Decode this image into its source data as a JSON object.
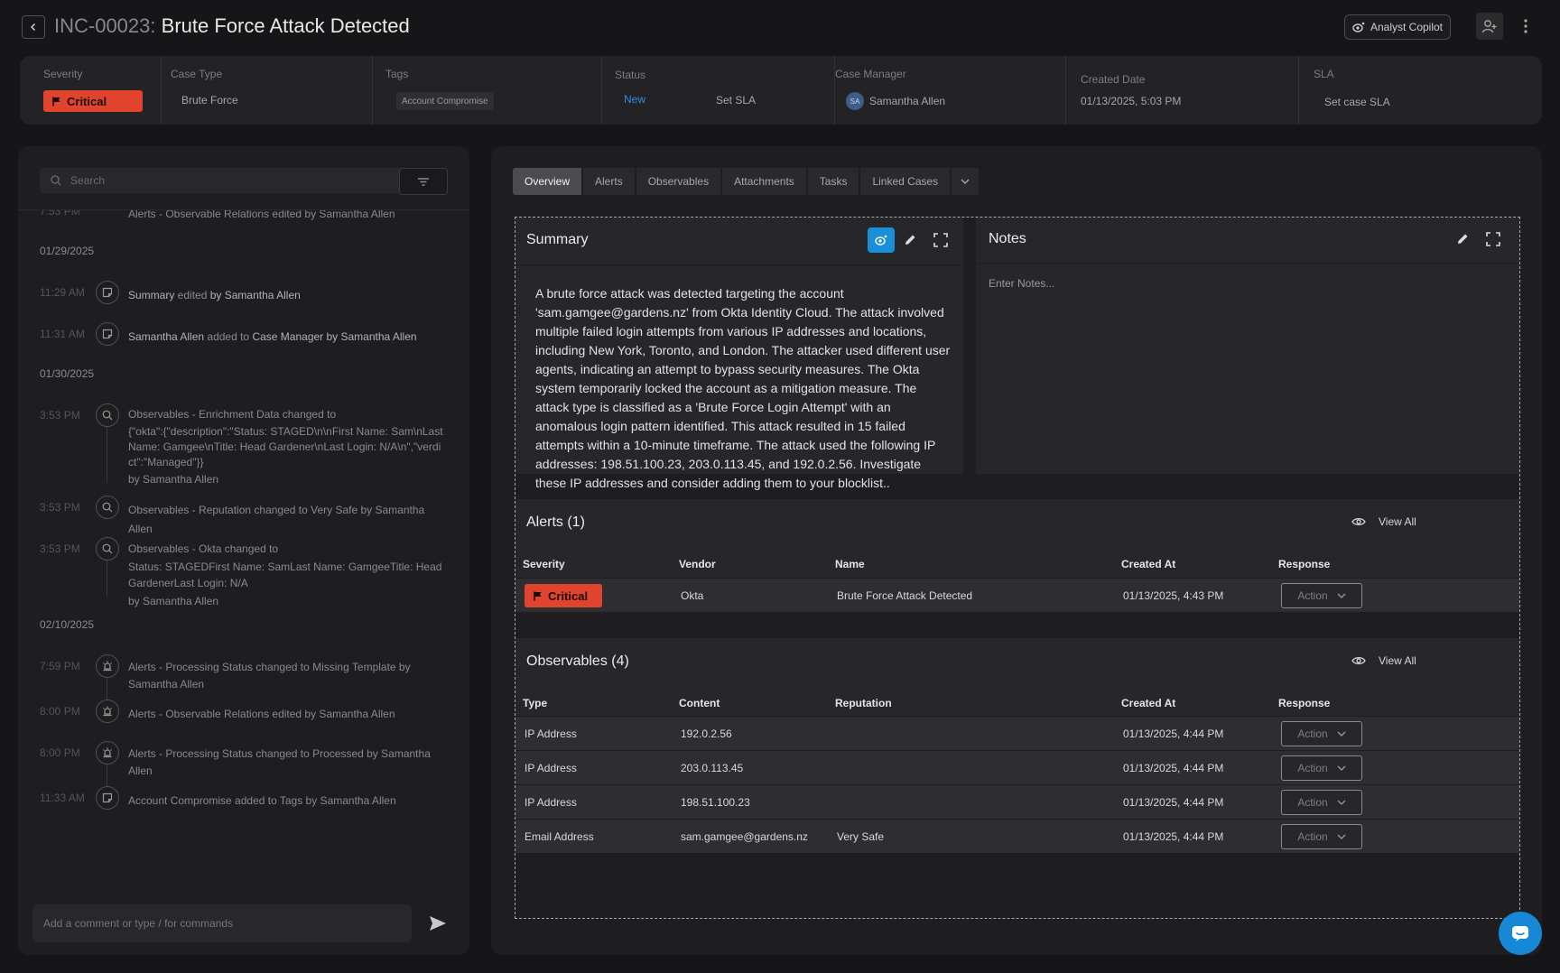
{
  "header": {
    "incident_id": "INC-00023:",
    "incident_title": "Brute Force Attack Detected",
    "copilot_label": "Analyst Copilot"
  },
  "info": {
    "severity_label": "Severity",
    "severity_value": "Critical",
    "case_type_label": "Case Type",
    "case_type_value": "Brute Force",
    "tags_label": "Tags",
    "tag_value": "Account Compromise",
    "status_label": "Status",
    "status_value": "New",
    "set_sla": "Set SLA",
    "case_manager_label": "Case Manager",
    "case_manager_initials": "SA",
    "case_manager_value": "Samantha Allen",
    "created_date_label": "Created Date",
    "created_date_value": "01/13/2025, 5:03 PM",
    "sla_label": "SLA",
    "sla_value": "Set case SLA",
    "colors": {
      "critical": "#e0432e",
      "status_new": "#2d8fe0"
    }
  },
  "activity": {
    "search_placeholder": "Search",
    "partial_top": {
      "time": "7:53 PM",
      "text": "Alerts - Observable Relations edited by Samantha Allen"
    },
    "groups": [
      {
        "date": "01/29/2025",
        "items": [
          {
            "time": "11:29 AM",
            "icon": "note-icon",
            "segments": [
              "Summary",
              " edited ",
              "by Samantha Allen"
            ]
          },
          {
            "time": "11:31 AM",
            "icon": "note-icon",
            "segments": [
              "Samantha Allen",
              " added to ",
              "Case Manager by Samantha Allen"
            ]
          }
        ]
      },
      {
        "date": "01/30/2025",
        "items": [
          {
            "time": "3:53 PM",
            "icon": "search-icon",
            "line1": "Observables - Enrichment Data changed to",
            "line2": "{\"okta\":{\"description\":\"Status: STAGED\\n\\nFirst Name: Sam\\nLast Name: Gamgee\\nTitle: Head Gardener\\nLast Login: N/A\\n\",\"verdict\":\"Managed\"}}",
            "by": "by Samantha Allen"
          },
          {
            "time": "3:53 PM",
            "icon": "search-icon",
            "line1": "Observables - Reputation changed to Very Safe by Samantha Allen"
          },
          {
            "time": "3:53 PM",
            "icon": "search-icon",
            "line1": "Observables - Okta changed to",
            "line2": "Status: STAGEDFirst Name: SamLast Name: GamgeeTitle: Head GardenerLast Login: N/A",
            "by": "by Samantha Allen"
          }
        ]
      },
      {
        "date": "02/10/2025",
        "items": [
          {
            "time": "7:59 PM",
            "icon": "siren-icon",
            "line1": "Alerts - Processing Status changed to Missing Template by Samantha Allen"
          },
          {
            "time": "8:00 PM",
            "icon": "siren-icon",
            "line1": "Alerts - Observable Relations edited by Samantha Allen"
          },
          {
            "time": "8:00 PM",
            "icon": "siren-icon",
            "line1": "Alerts - Processing Status changed to Processed by Samantha Allen"
          },
          {
            "time": "11:33 AM",
            "icon": "note-icon",
            "line1": "Account Compromise added to Tags by Samantha Allen"
          }
        ]
      }
    ],
    "comment_placeholder": "Add a comment or type / for commands"
  },
  "tabs": [
    "Overview",
    "Alerts",
    "Observables",
    "Attachments",
    "Tasks",
    "Linked Cases"
  ],
  "summary": {
    "title": "Summary",
    "text": "A brute force attack was detected targeting the account 'sam.gamgee@gardens.nz' from Okta Identity Cloud. The attack involved multiple failed login attempts from various IP addresses and locations, including New York, Toronto, and London. The attacker used different user agents, indicating an attempt to bypass security measures.  The Okta system temporarily locked the account as a mitigation measure. The attack type is classified as a 'Brute Force Login Attempt' with an anomalous login pattern identified. This attack resulted in 15 failed attempts within a 10-minute timeframe.  The attack used the following IP addresses: 198.51.100.23, 203.0.113.45, and 192.0.2.56.  Investigate these IP addresses and consider adding them to your blocklist.."
  },
  "notes": {
    "title": "Notes",
    "placeholder": "Enter Notes..."
  },
  "alerts": {
    "title": "Alerts (1)",
    "view_all": "View All",
    "columns": [
      "Severity",
      "Vendor",
      "Name",
      "Created At",
      "Response"
    ],
    "rows": [
      {
        "severity": "Critical",
        "vendor": "Okta",
        "name": "Brute Force Attack Detected",
        "created_at": "01/13/2025, 4:43 PM",
        "response": "Action"
      }
    ]
  },
  "observables": {
    "title": "Observables (4)",
    "view_all": "View All",
    "columns": [
      "Type",
      "Content",
      "Reputation",
      "Created At",
      "Response"
    ],
    "rows": [
      {
        "type": "IP Address",
        "content": "192.0.2.56",
        "reputation": "",
        "created_at": "01/13/2025, 4:44 PM",
        "response": "Action"
      },
      {
        "type": "IP Address",
        "content": "203.0.113.45",
        "reputation": "",
        "created_at": "01/13/2025, 4:44 PM",
        "response": "Action"
      },
      {
        "type": "IP Address",
        "content": "198.51.100.23",
        "reputation": "",
        "created_at": "01/13/2025, 4:44 PM",
        "response": "Action"
      },
      {
        "type": "Email Address",
        "content": "sam.gamgee@gardens.nz",
        "reputation": "Very Safe",
        "created_at": "01/13/2025, 4:44 PM",
        "response": "Action"
      }
    ]
  }
}
